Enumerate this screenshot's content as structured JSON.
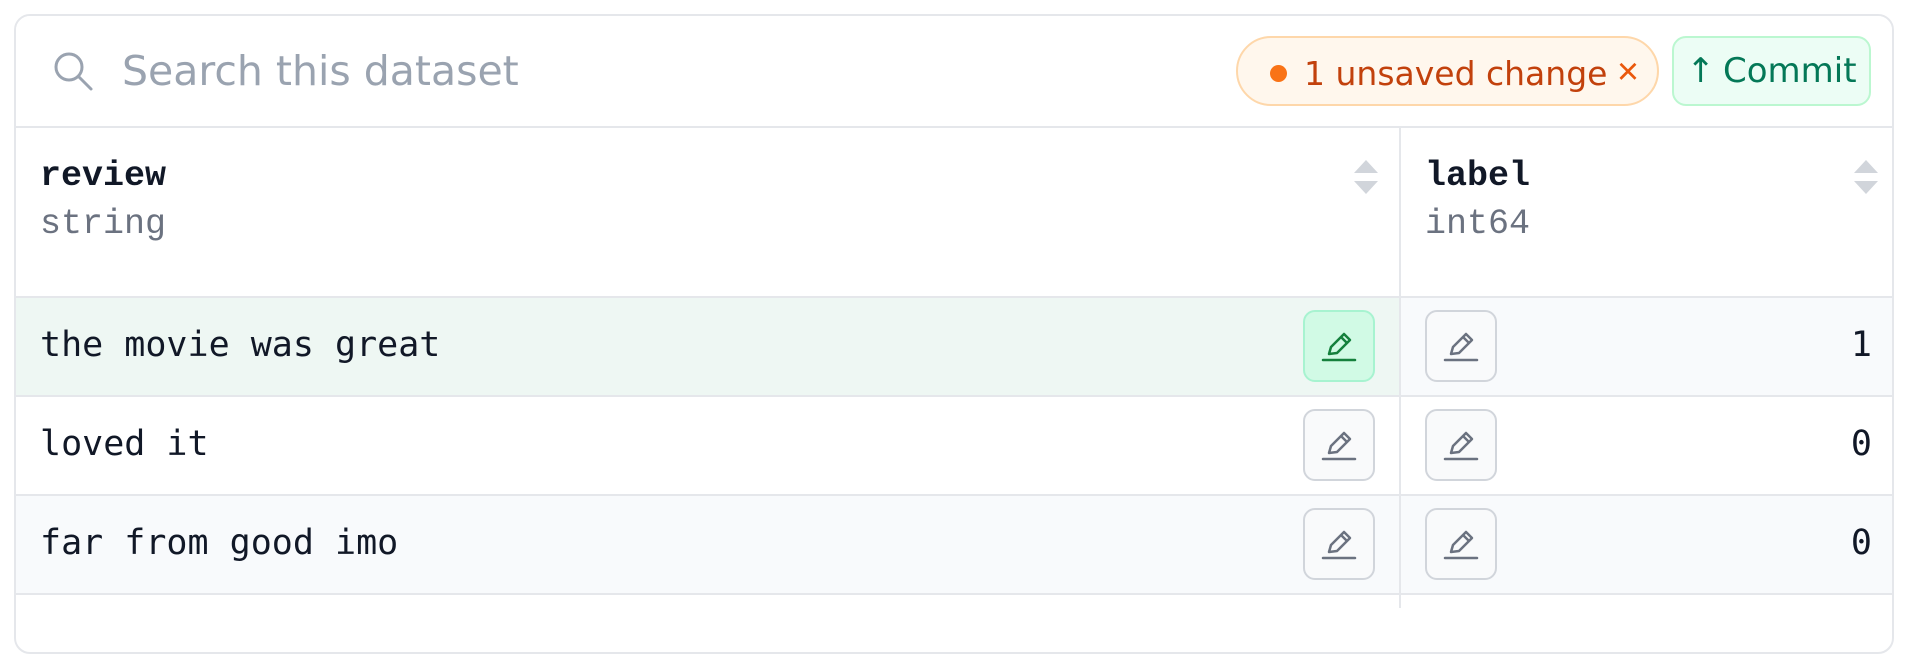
{
  "search": {
    "placeholder": "Search this dataset",
    "value": ""
  },
  "changes": {
    "label": "1 unsaved change",
    "close_glyph": "×",
    "dot_color": "#f97316"
  },
  "commit": {
    "label": "Commit",
    "arrow": "↑"
  },
  "columns": [
    {
      "name": "review",
      "type": "string"
    },
    {
      "name": "label",
      "type": "int64"
    }
  ],
  "rows": [
    {
      "review": "the movie was great",
      "label": "1",
      "edited": true
    },
    {
      "review": "loved it",
      "label": "0",
      "edited": false
    },
    {
      "review": "far from good imo",
      "label": "0",
      "edited": false
    }
  ],
  "colors": {
    "accent_green": "#047857",
    "edited_row_bg": "#eef7f3",
    "stripe_bg": "#f8fafc",
    "warning_text": "#c2410c"
  }
}
